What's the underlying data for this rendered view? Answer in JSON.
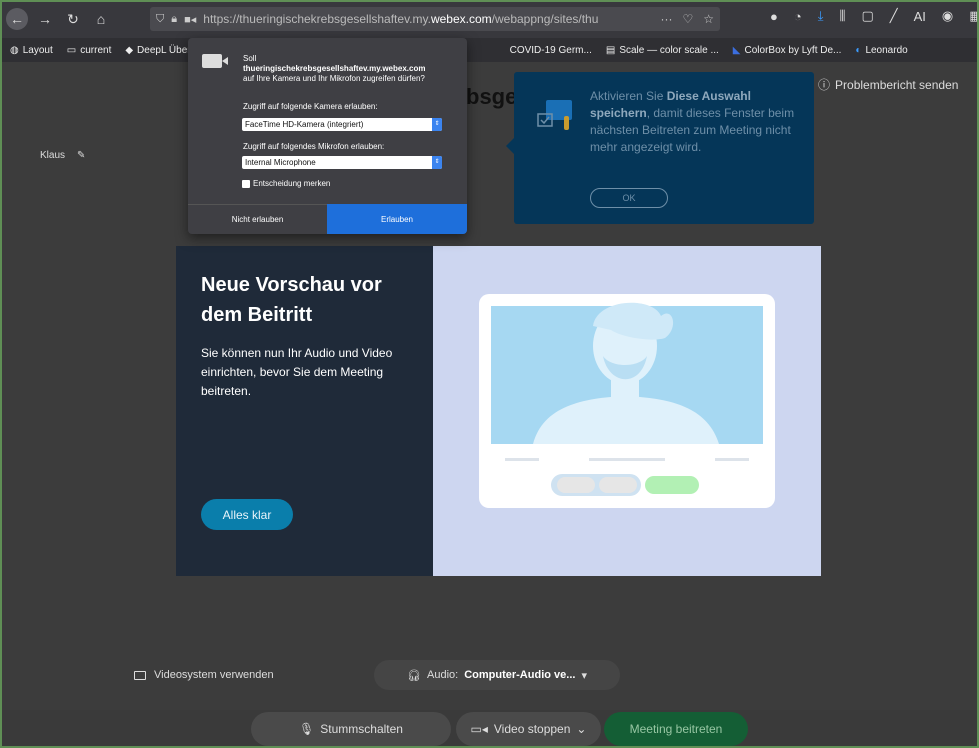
{
  "browser": {
    "url_prefix": "https://thueringischekrebsgesellshaftev.my.",
    "url_domain": "webex.com",
    "url_suffix": "/webappng/sites/thu",
    "url_menu": "···",
    "toolbar_right_badge": "AI"
  },
  "bookmarks": [
    {
      "label": "Layout",
      "icon": "globe-icon"
    },
    {
      "label": "current",
      "icon": "folder-icon"
    },
    {
      "label": "DeepL Übers",
      "icon": "deepl-icon"
    },
    {
      "label": "COVID-19 Germ...",
      "icon": "page-icon"
    },
    {
      "label": "Scale — color scale ...",
      "icon": "grid-icon"
    },
    {
      "label": "ColorBox by Lyft De...",
      "icon": "colorbox-icon"
    },
    {
      "label": "Leonardo",
      "icon": "leonardo-icon"
    }
  ],
  "permission": {
    "intro": "Soll",
    "host": "thueringischekrebsgesellshaftev.my.webex.com",
    "question": "auf Ihre Kamera und Ihr Mikrofon zugreifen dürfen?",
    "camera_label": "Zugriff auf folgende Kamera erlauben:",
    "camera_value": "FaceTime HD-Kamera (integriert)",
    "mic_label": "Zugriff auf folgendes Mikrofon erlauben:",
    "mic_value": "Internal Microphone",
    "remember": "Entscheidung merken",
    "deny": "Nicht erlauben",
    "allow": "Erlauben"
  },
  "page": {
    "user_name": "Klaus",
    "title_fragment": "bsge",
    "report_label": "Problembericht senden"
  },
  "tooltip": {
    "lead": "Aktivieren Sie",
    "bold": "Diese Auswahl speichern",
    "rest": ", damit dieses Fenster beim nächsten Beitreten zum Meeting nicht mehr angezeigt wird.",
    "ok": "OK"
  },
  "preview": {
    "title": "Neue Vorschau vor dem Beitritt",
    "description": "Sie können nun Ihr Audio und Video einrichten, bevor Sie dem Meeting beitreten.",
    "button": "Alles klar"
  },
  "controls": {
    "video_system": "Videosystem verwenden",
    "audio_prefix": "Audio:",
    "audio_value": "Computer-Audio ve...",
    "mute": "Stummschalten",
    "video_stop": "Video stoppen",
    "join": "Meeting beitreten"
  }
}
